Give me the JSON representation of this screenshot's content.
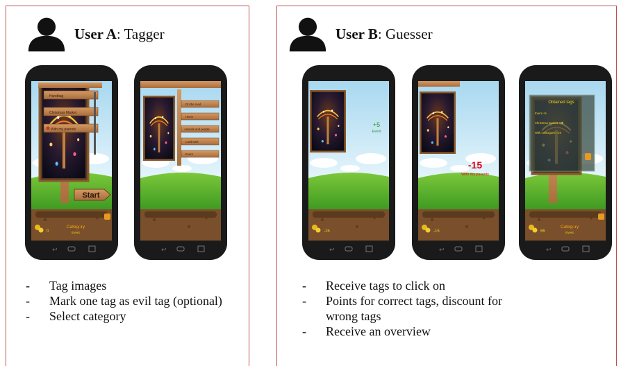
{
  "colors": {
    "frame": "#c0504d",
    "sky": "#bfe3f5",
    "grass": "#58b52f",
    "soil": "#7a4f2b",
    "wood": "#b07a4a",
    "red_score": "#e2001a",
    "green_score": "#2e9b2e",
    "yellow_text": "#f1d21c"
  },
  "user_a": {
    "name": "User A",
    "role": ": Tagger",
    "icon": "user-silhouette-icon",
    "phone1": {
      "tags": [
        "Handbag",
        "Christmas Market",
        "With my parents"
      ],
      "start_label": "Start",
      "coins": "0",
      "category_label": "Category",
      "category_value": "Event"
    },
    "phone2": {
      "tags": [
        "On the road",
        "Home",
        "Animals and people",
        "Landmark",
        "Event"
      ]
    },
    "bullets": [
      "Tag images",
      "Mark one tag as evil tag (optional)",
      "Select category"
    ]
  },
  "user_b": {
    "name": "User B",
    "role": ": Guesser",
    "icon": "user-silhouette-icon",
    "phone1": {
      "score": "+5",
      "score_tag": "Event",
      "coins": "-15"
    },
    "phone2": {
      "score": "-15",
      "score_tag": "With my parents",
      "coins": "-15"
    },
    "phone3": {
      "overview_title": "Obtained tags",
      "overview_items": [
        "Event +5",
        "Christmas market +25",
        "With colleagues +15"
      ],
      "coins": "65",
      "category_label": "Category",
      "category_value": "Event"
    },
    "bullets": [
      "Receive tags to click on",
      "Points for correct tags, discount for wrong tags",
      "Receive an overview"
    ]
  }
}
